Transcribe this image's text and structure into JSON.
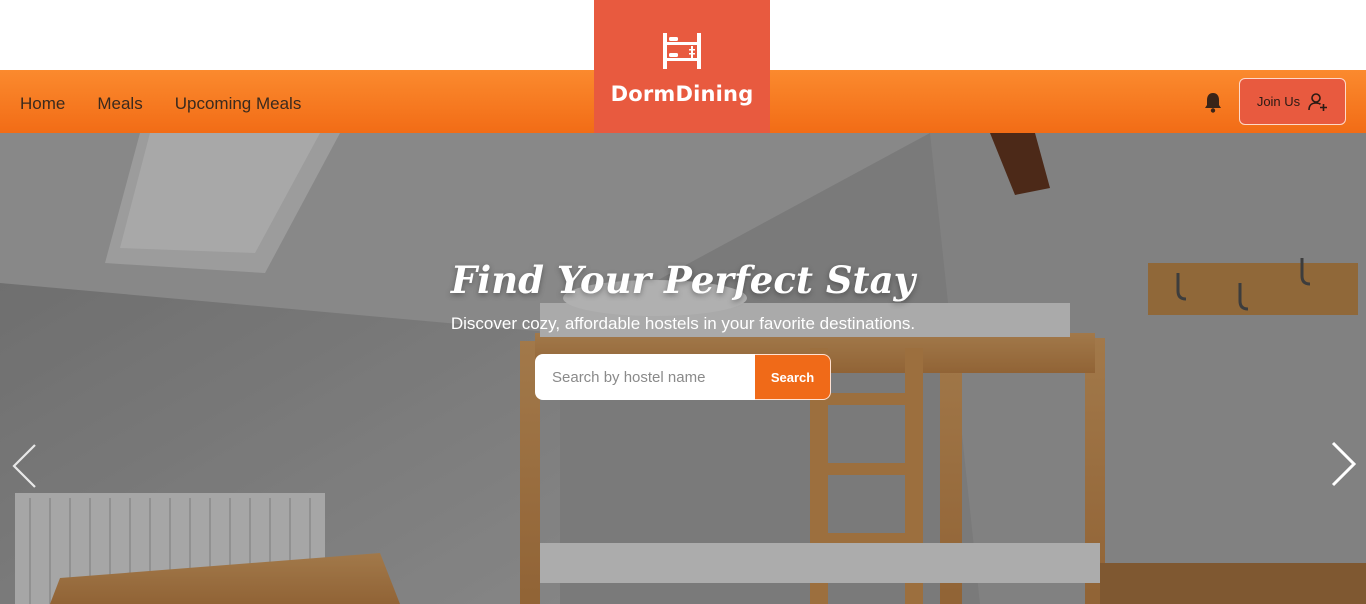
{
  "brand": {
    "name": "DormDining",
    "icon": "bunk-bed-icon",
    "logo_bg": "#e85a3f"
  },
  "nav": {
    "items": [
      {
        "label": "Home"
      },
      {
        "label": "Meals"
      },
      {
        "label": "Upcoming Meals"
      }
    ],
    "gradient": [
      "#fb8a2e",
      "#f26c16"
    ]
  },
  "actions": {
    "notification_icon": "bell-icon",
    "join_label": "Join Us",
    "join_icon": "user-plus-icon"
  },
  "hero": {
    "title": "Find Your Perfect Stay",
    "subtitle": "Discover cozy, affordable hostels in your favorite destinations.",
    "search": {
      "placeholder": "Search by hostel name",
      "value": "",
      "button_label": "Search"
    },
    "prev_icon": "chevron-left-icon",
    "next_icon": "chevron-right-icon"
  }
}
